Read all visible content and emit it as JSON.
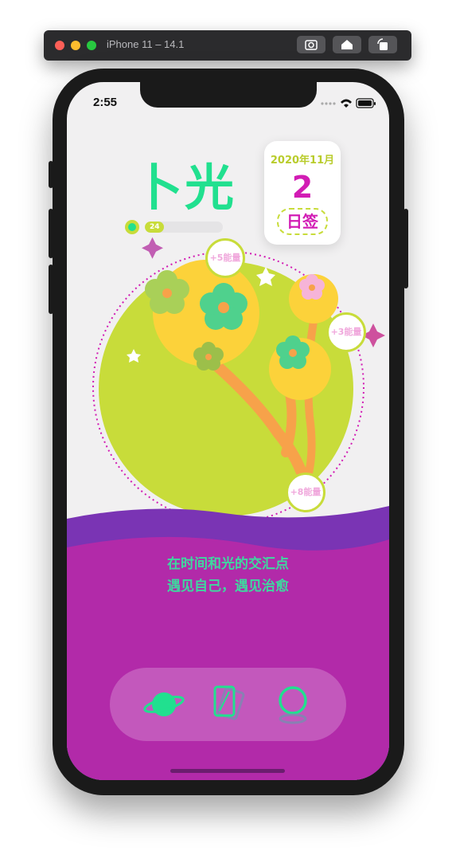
{
  "simulator": {
    "title": "iPhone 11 – 14.1",
    "buttons": [
      "screenshot-icon",
      "home-icon",
      "rotate-icon"
    ]
  },
  "status_bar": {
    "time": "2:55"
  },
  "app": {
    "title": "卜光",
    "energy": {
      "value": "24",
      "fraction": 0.24
    },
    "date_card": {
      "year_month": "2020年11月",
      "day": "2",
      "sign_label": "日签"
    },
    "bubbles": [
      {
        "label": "+5能量"
      },
      {
        "label": "+3能量"
      },
      {
        "label": "+8能量"
      }
    ],
    "tagline": [
      "在时间和光的交汇点",
      "遇见自己，遇见治愈"
    ],
    "tabs": [
      {
        "icon": "planet-icon",
        "active": true
      },
      {
        "icon": "cards-icon",
        "active": false
      },
      {
        "icon": "mirror-icon",
        "active": false
      }
    ]
  },
  "colors": {
    "accent_green": "#21e08f",
    "lime": "#c8dc3a",
    "magenta": "#d21cb4",
    "purple_wave": "#7a34b4",
    "purple_bg": "#b22aa9"
  }
}
